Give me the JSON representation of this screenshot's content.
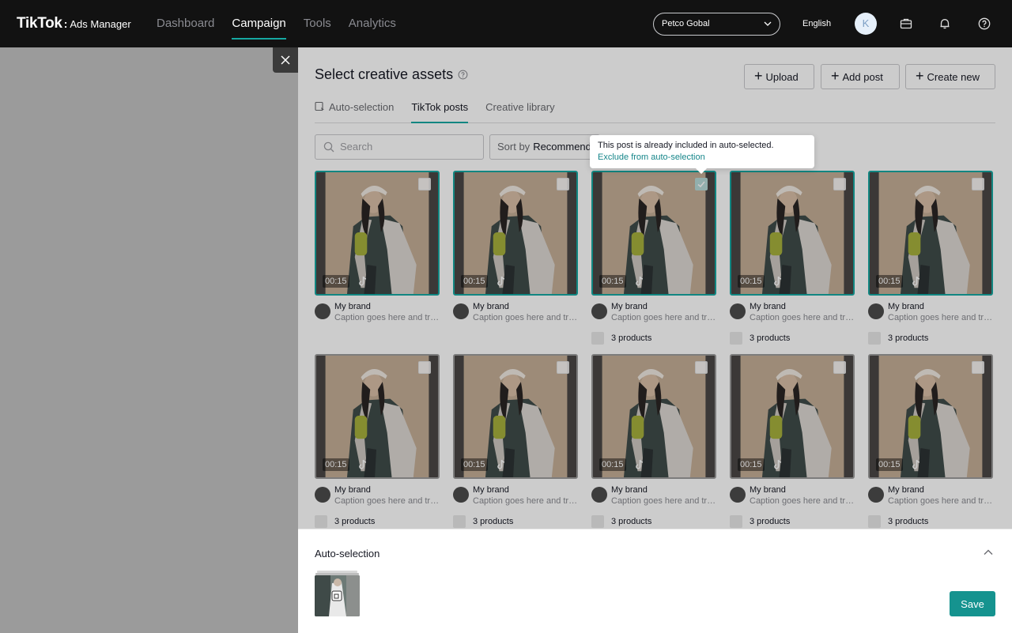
{
  "topbar": {
    "logo_brand": "TikTok",
    "logo_colon": ":",
    "logo_product": "Ads Manager",
    "nav": [
      "Dashboard",
      "Campaign",
      "Tools",
      "Analytics"
    ],
    "active_nav": "Campaign",
    "account": "Petco Gobal",
    "language": "English",
    "avatar_initial": "K",
    "icons": [
      "briefcase-icon",
      "bell-icon",
      "help-icon"
    ]
  },
  "drawer": {
    "title": "Select creative assets",
    "buttons": {
      "upload": "Upload",
      "add_post": "Add post",
      "create_new": "Create new"
    },
    "tabs": [
      "Auto-selection",
      "TikTok posts",
      "Creative library"
    ],
    "active_tab": "TikTok posts",
    "search_placeholder": "Search",
    "sort_label": "Sort by",
    "sort_value": "Recommended",
    "tooltip": {
      "message": "This post is already included in auto-selected.",
      "link": "Exclude from auto-selection"
    }
  },
  "posts": [
    {
      "duration": "00:15",
      "brand": "My brand",
      "caption": "Caption goes here and truncated",
      "products": "",
      "checked": false
    },
    {
      "duration": "00:15",
      "brand": "My brand",
      "caption": "Caption goes here and truncated",
      "products": "",
      "checked": false
    },
    {
      "duration": "00:15",
      "brand": "My brand",
      "caption": "Caption goes here and truncated",
      "products": "3 products",
      "checked": true
    },
    {
      "duration": "00:15",
      "brand": "My brand",
      "caption": "Caption goes here and truncated",
      "products": "3 products",
      "checked": false
    },
    {
      "duration": "00:15",
      "brand": "My brand",
      "caption": "Caption goes here and truncated",
      "products": "3 products",
      "checked": false
    },
    {
      "duration": "00:15",
      "brand": "My brand",
      "caption": "Caption goes here and truncated",
      "products": "3 products",
      "checked": false
    },
    {
      "duration": "00:15",
      "brand": "My brand",
      "caption": "Caption goes here and truncated",
      "products": "3 products",
      "checked": false
    },
    {
      "duration": "00:15",
      "brand": "My brand",
      "caption": "Caption goes here and truncated",
      "products": "3 products",
      "checked": false
    },
    {
      "duration": "00:15",
      "brand": "My brand",
      "caption": "Caption goes here and truncated",
      "products": "3 products",
      "checked": false
    },
    {
      "duration": "00:15",
      "brand": "My brand",
      "caption": "Caption goes here and truncated",
      "products": "3 products",
      "checked": false
    }
  ],
  "footer": {
    "title": "Auto-selection",
    "save": "Save"
  },
  "colors": {
    "accent": "#16a8a2",
    "save_button": "#15938f",
    "topbar": "#121212",
    "link": "#16868a"
  }
}
